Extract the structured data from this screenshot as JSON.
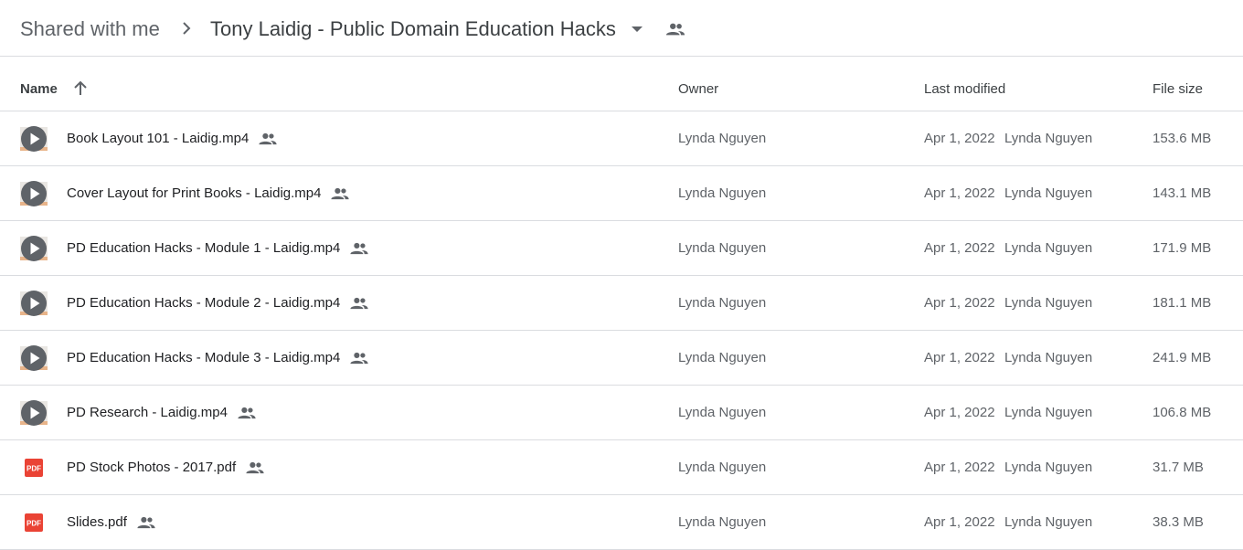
{
  "breadcrumb": {
    "root": "Shared with me",
    "current": "Tony Laidig - Public Domain Education Hacks"
  },
  "columns": {
    "name": "Name",
    "owner": "Owner",
    "last_modified": "Last modified",
    "file_size": "File size"
  },
  "colors": {
    "pdf_red": "#ea4335",
    "video_gray": "#5f6368",
    "divider": "#dadce0"
  },
  "files": [
    {
      "name": "Book Layout 101 - Laidig.mp4",
      "type": "video",
      "icon": "video-play-icon",
      "owner": "Lynda Nguyen",
      "modified": "Apr 1, 2022",
      "modified_by": "Lynda Nguyen",
      "size": "153.6 MB"
    },
    {
      "name": "Cover Layout for Print Books - Laidig.mp4",
      "type": "video",
      "icon": "video-play-icon",
      "owner": "Lynda Nguyen",
      "modified": "Apr 1, 2022",
      "modified_by": "Lynda Nguyen",
      "size": "143.1 MB"
    },
    {
      "name": "PD Education Hacks - Module 1 - Laidig.mp4",
      "type": "video",
      "icon": "video-play-icon",
      "owner": "Lynda Nguyen",
      "modified": "Apr 1, 2022",
      "modified_by": "Lynda Nguyen",
      "size": "171.9 MB"
    },
    {
      "name": "PD Education Hacks - Module 2 - Laidig.mp4",
      "type": "video",
      "icon": "video-play-icon",
      "owner": "Lynda Nguyen",
      "modified": "Apr 1, 2022",
      "modified_by": "Lynda Nguyen",
      "size": "181.1 MB"
    },
    {
      "name": "PD Education Hacks - Module 3 - Laidig.mp4",
      "type": "video",
      "icon": "video-play-icon",
      "owner": "Lynda Nguyen",
      "modified": "Apr 1, 2022",
      "modified_by": "Lynda Nguyen",
      "size": "241.9 MB"
    },
    {
      "name": "PD Research - Laidig.mp4",
      "type": "video",
      "icon": "video-play-icon",
      "owner": "Lynda Nguyen",
      "modified": "Apr 1, 2022",
      "modified_by": "Lynda Nguyen",
      "size": "106.8 MB"
    },
    {
      "name": "PD Stock Photos - 2017.pdf",
      "type": "pdf",
      "icon": "pdf-icon",
      "owner": "Lynda Nguyen",
      "modified": "Apr 1, 2022",
      "modified_by": "Lynda Nguyen",
      "size": "31.7 MB"
    },
    {
      "name": "Slides.pdf",
      "type": "pdf",
      "icon": "pdf-icon",
      "owner": "Lynda Nguyen",
      "modified": "Apr 1, 2022",
      "modified_by": "Lynda Nguyen",
      "size": "38.3 MB"
    }
  ],
  "pdf_badge": "PDF"
}
